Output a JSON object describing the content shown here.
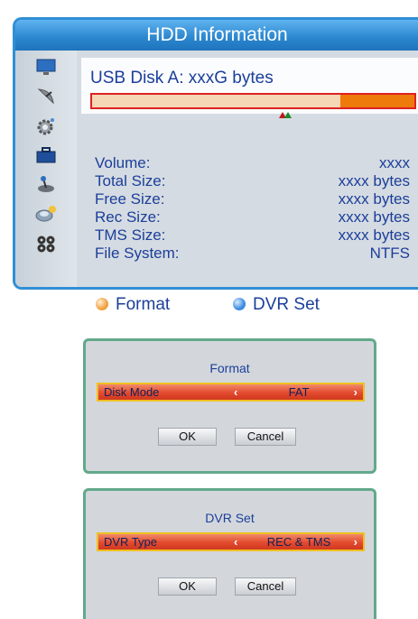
{
  "hdd": {
    "title": "HDD Information",
    "disk_label": "USB Disk A: xxxG bytes",
    "usage_fraction": 0.23,
    "info": [
      {
        "label": "Volume:",
        "value": "xxxx"
      },
      {
        "label": "Total Size:",
        "value": "xxxx bytes"
      },
      {
        "label": "Free Size:",
        "value": "xxxx bytes"
      },
      {
        "label": "Rec Size:",
        "value": "xxxx bytes"
      },
      {
        "label": "TMS Size:",
        "value": "xxxx bytes"
      },
      {
        "label": "File System:",
        "value": "NTFS"
      }
    ],
    "side_icons": [
      "monitor-icon",
      "satellite-dish-icon",
      "gear-icon",
      "toolbox-icon",
      "joystick-icon",
      "usb-disk-icon",
      "film-reel-icon"
    ]
  },
  "legend": {
    "format": {
      "label": "Format",
      "color": "#f0a040"
    },
    "dvr": {
      "label": "DVR Set",
      "color": "#3a8be0"
    }
  },
  "format_dialog": {
    "title": "Format",
    "row_label": "Disk Mode",
    "row_value": "FAT",
    "ok": "OK",
    "cancel": "Cancel"
  },
  "dvr_dialog": {
    "title": "DVR Set",
    "row_label": "DVR Type",
    "row_value": "REC & TMS",
    "ok": "OK",
    "cancel": "Cancel"
  },
  "colors": {
    "accent_blue": "#2f8fd6",
    "label_blue": "#1b3f9a",
    "highlight_red": "#e34a2e",
    "dialog_border": "#62a98a"
  }
}
